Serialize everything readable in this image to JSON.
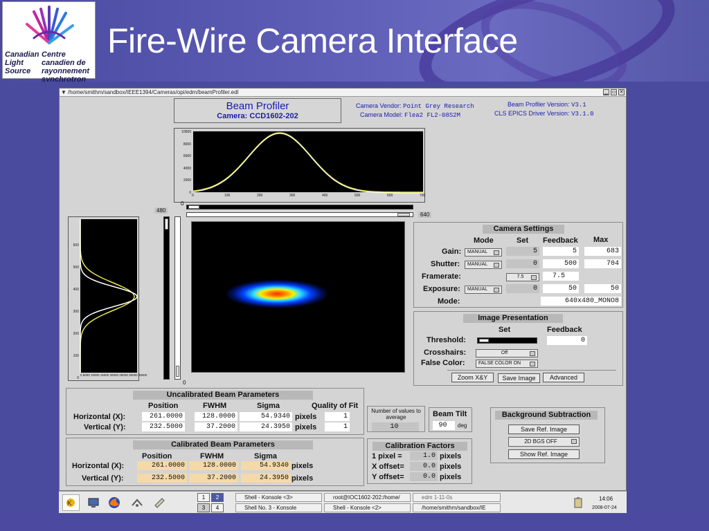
{
  "slide": {
    "title": "Fire-Wire Camera Interface",
    "logo_en": "Canadian Light Source",
    "logo_fr": "Centre canadien de rayonnement synchrotron"
  },
  "window": {
    "path": "/home/smithm/sandbox/IEEE1394/Cameras/opi/edm/beamProfiler.edl",
    "header_title": "Beam Profiler",
    "header_camera": "Camera: CCD1602-202",
    "vendor_label": "Camera Vendor:",
    "vendor_value": "Point Grey Research",
    "model_label": "Camera Model:",
    "model_value": "Flea2 FL2-08S2M",
    "bp_version_label": "Beam Profiler Version:",
    "bp_version_value": "V3.1",
    "epics_label": "CLS EPICS Driver Version:",
    "epics_value": "V3.1.0"
  },
  "profile": {
    "x_ticks_y": [
      "10000",
      "8000",
      "6000",
      "4000",
      "2000",
      "0"
    ],
    "x_ticks_x": [
      "0",
      "100",
      "200",
      "300",
      "400",
      "500",
      "600",
      "700"
    ],
    "y_ticks_left": [
      "600",
      "500",
      "400",
      "300",
      "200",
      "100",
      "0"
    ],
    "y_ticks_bottom": "0 5000 10000 15000 20000 25000 30000 35000",
    "zero_top": "0",
    "label_480": "480",
    "label_640": "640",
    "zero_side": "0"
  },
  "camera_settings": {
    "title": "Camera Settings",
    "col_mode": "Mode",
    "col_set": "Set",
    "col_feedback": "Feedback",
    "col_max": "Max",
    "gain_label": "Gain:",
    "gain_mode": "MANUAL",
    "gain_set": "5",
    "gain_fb": "5",
    "gain_max": "683",
    "shutter_label": "Shutter:",
    "shutter_mode": "MANUAL",
    "shutter_set": "0",
    "shutter_fb": "500",
    "shutter_max": "704",
    "framerate_label": "Framerate:",
    "framerate_mode": "7.5",
    "framerate_fb": "7.5",
    "exposure_label": "Exposure:",
    "exposure_mode": "MANUAL",
    "exposure_set": "0",
    "exposure_fb": "50",
    "exposure_max": "50",
    "mode_label": "Mode:",
    "mode_value": "640x480_MONO8"
  },
  "image_presentation": {
    "title": "Image Presentation",
    "col_set": "Set",
    "col_feedback": "Feedback",
    "threshold_label": "Threshold:",
    "threshold_fb": "0",
    "crosshairs_label": "Crosshairs:",
    "crosshairs_value": "Off",
    "falsecolor_label": "False Color:",
    "falsecolor_value": "FALSE COLOR ON",
    "zoom_btn": "Zoom X&Y",
    "save_btn": "Save Image",
    "advanced_btn": "Advanced"
  },
  "uncalibrated": {
    "title": "Uncalibrated Beam Parameters",
    "col_position": "Position",
    "col_fwhm": "FWHM",
    "col_sigma": "Sigma",
    "col_quality": "Quality of Fit",
    "h_label": "Horizontal (X):",
    "h_pos": "261.0000",
    "h_fwhm": "128.0000",
    "h_sigma": "54.9340",
    "h_unit": "pixels",
    "h_quality": "1",
    "v_label": "Vertical (Y):",
    "v_pos": "232.5000",
    "v_fwhm": "37.2000",
    "v_sigma": "24.3950",
    "v_unit": "pixels",
    "v_quality": "1"
  },
  "averaging": {
    "label": "Number of values to average",
    "value": "10"
  },
  "tilt": {
    "label": "Beam Tilt",
    "value": "90",
    "unit": "deg"
  },
  "background": {
    "title": "Background Subtraction",
    "save_ref": "Save Ref. Image",
    "bgs": "2D BGS OFF",
    "show_ref": "Show Ref. Image"
  },
  "calibrated": {
    "title": "Calibrated Beam Parameters",
    "col_position": "Position",
    "col_fwhm": "FWHM",
    "col_sigma": "Sigma",
    "h_label": "Horizontal (X):",
    "h_pos": "261.0000",
    "h_fwhm": "128.0000",
    "h_sigma": "54.9340",
    "h_unit": "pixels",
    "v_label": "Vertical (Y):",
    "v_pos": "232.5000",
    "v_fwhm": "37.2000",
    "v_sigma": "24.3950",
    "v_unit": "pixels"
  },
  "calibration": {
    "title": "Calibration Factors",
    "pixel_label": "1 pixel =",
    "pixel_value": "1.0",
    "pixel_unit": "pixels",
    "xoff_label": "X offset=",
    "xoff_value": "0.0",
    "xoff_unit": "pixels",
    "yoff_label": "Y offset=",
    "yoff_value": "0.0",
    "yoff_unit": "pixels"
  },
  "taskbar": {
    "pager": [
      "1",
      "2",
      "3",
      "4"
    ],
    "tasks": [
      "Shell - Konsole <3>",
      "root@IOC1602-202:/home/",
      "edm 1-11-0s",
      "Shell No. 3 - Konsole",
      "Shell - Konsole <2>",
      "/home/smithm/sandbox/IE"
    ],
    "time": "14:06",
    "date": "2008-07-24"
  }
}
